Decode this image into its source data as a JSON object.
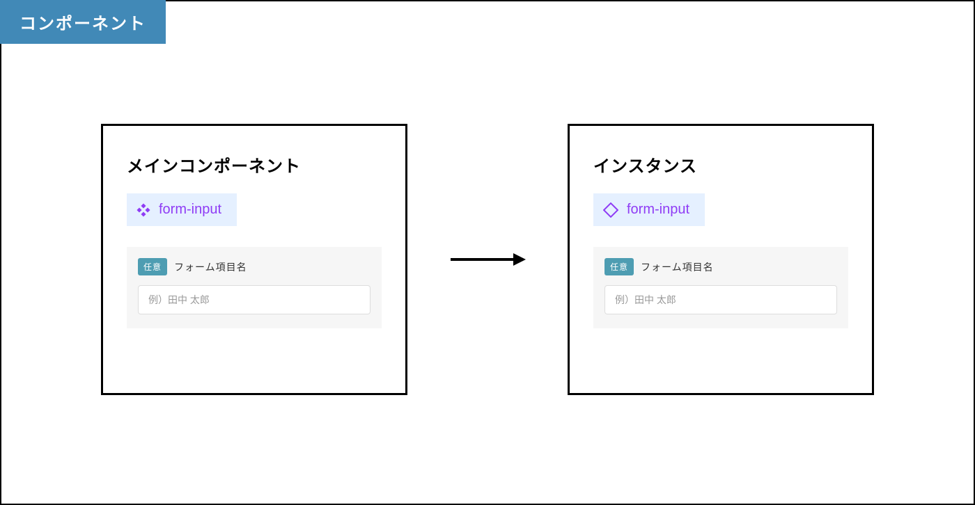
{
  "header": {
    "tag": "コンポーネント"
  },
  "left_panel": {
    "title": "メインコンポーネント",
    "chip": {
      "icon": "component-main-icon",
      "label": "form-input"
    },
    "form": {
      "badge": "任意",
      "label": "フォーム項目名",
      "placeholder": "例）田中 太郎"
    }
  },
  "right_panel": {
    "title": "インスタンス",
    "chip": {
      "icon": "component-instance-icon",
      "label": "form-input"
    },
    "form": {
      "badge": "任意",
      "label": "フォーム項目名",
      "placeholder": "例）田中 太郎"
    }
  },
  "colors": {
    "accent_blue": "#4189b7",
    "chip_bg": "#e5f0ff",
    "chip_text": "#8f3cf5",
    "badge_teal": "#4e9db2",
    "form_bg": "#f6f6f6"
  }
}
